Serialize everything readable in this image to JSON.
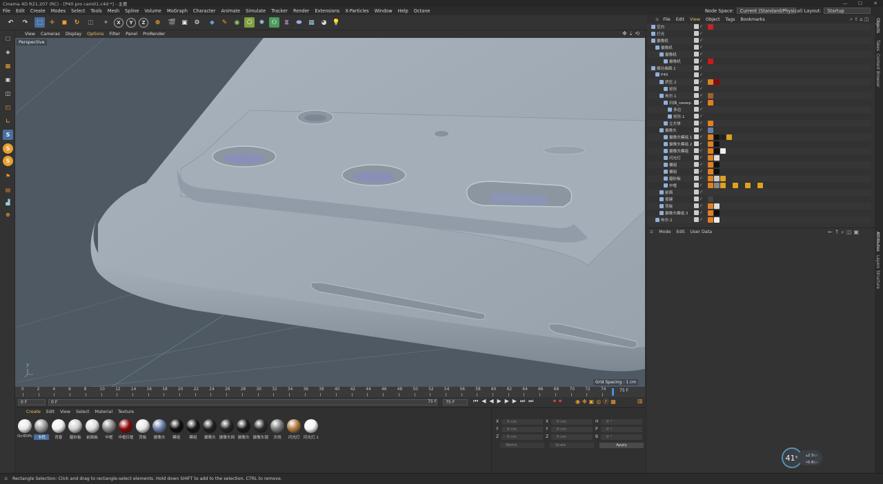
{
  "window": {
    "title": "Cinema 4D R21.207 (RC) - [P40 pro cam01.c4d *] - 主要",
    "min": "—",
    "max": "☐",
    "close": "✕"
  },
  "menubar": {
    "items": [
      "File",
      "Edit",
      "Create",
      "Modes",
      "Select",
      "Tools",
      "Mesh",
      "Spline",
      "Volume",
      "MoGraph",
      "Character",
      "Animate",
      "Simulate",
      "Tracker",
      "Render",
      "Extensions",
      "X-Particles",
      "Window",
      "Help",
      "Octane"
    ],
    "node_space_label": "Node Space:",
    "node_space_value": "Current (Standard/Physical)",
    "layout_label": "Layout:",
    "layout_value": "Startup"
  },
  "toolbar": {
    "axis_x": "X",
    "axis_y": "Y",
    "axis_z": "Z"
  },
  "viewport": {
    "menu": [
      "View",
      "Cameras",
      "Display",
      "Options",
      "Filter",
      "Panel",
      "ProRender"
    ],
    "camera_label": "Perspective",
    "grid_spacing": "Grid Spacing : 1 cm"
  },
  "timeline": {
    "ticks": [
      "0",
      "2",
      "4",
      "6",
      "8",
      "10",
      "12",
      "14",
      "16",
      "18",
      "20",
      "22",
      "24",
      "26",
      "28",
      "30",
      "32",
      "34",
      "36",
      "38",
      "40",
      "42",
      "44",
      "46",
      "48",
      "50",
      "52",
      "54",
      "56",
      "58",
      "60",
      "62",
      "64",
      "66",
      "68",
      "70",
      "72",
      "74"
    ],
    "current": "75 F"
  },
  "playbar": {
    "start": "0 F",
    "start2": "0 F",
    "end": "75 F",
    "end2": "75 F"
  },
  "materials": {
    "menu": [
      "Create",
      "Edit",
      "View",
      "Select",
      "Material",
      "Texture"
    ],
    "items": [
      {
        "label": "OctDiffu",
        "color": "#e8e8e8"
      },
      {
        "label": "卡托",
        "color": "#9a9a9a"
      },
      {
        "label": "背景",
        "color": "#f0f0f0"
      },
      {
        "label": "磨砂板",
        "color": "#d0d0d0"
      },
      {
        "label": "前面板",
        "color": "#dcdcdc"
      },
      {
        "label": "中框",
        "color": "#8a8a8a"
      },
      {
        "label": "中框红框",
        "color": "#8a0a0a"
      },
      {
        "label": "背板",
        "color": "#e4e4e4"
      },
      {
        "label": "摄像头",
        "color": "#6a7fa8"
      },
      {
        "label": "模组",
        "color": "#0d0d0d"
      },
      {
        "label": "模组",
        "color": "#151515"
      },
      {
        "label": "摄像头",
        "color": "#202020"
      },
      {
        "label": "摄像头网",
        "color": "#252525"
      },
      {
        "label": "摄像头",
        "color": "#1a1a1a"
      },
      {
        "label": "摄像头镜",
        "color": "#2a2a2a"
      },
      {
        "label": "天线",
        "color": "#7a7a7a"
      },
      {
        "label": "闪光灯",
        "color": "#b07a40"
      },
      {
        "label": "闪光灯.1",
        "color": "#f4f4f4"
      }
    ]
  },
  "coords": {
    "x": "X",
    "y": "Y",
    "z": "Z",
    "h": "H",
    "p": "P",
    "b": "B",
    "pos_x": "0 cm",
    "pos_y": "0 cm",
    "pos_z": "0 cm",
    "size_x": "0 cm",
    "size_y": "0 cm",
    "size_z": "0 cm",
    "rot_h": "0 °",
    "rot_p": "0 °",
    "rot_b": "0 °",
    "world": "World",
    "scale": "Scale",
    "apply": "Apply"
  },
  "objects": {
    "menu": [
      "File",
      "Edit",
      "View",
      "Object",
      "Tags",
      "Bookmarks"
    ],
    "rows": [
      {
        "name": "空白",
        "indent": 0,
        "tags": [
          {
            "color": "#cc2222"
          }
        ]
      },
      {
        "name": "灯光",
        "indent": 0,
        "tags": []
      },
      {
        "name": "摄像机",
        "indent": 0,
        "tags": []
      },
      {
        "name": "摄像机",
        "indent": 1,
        "tags": []
      },
      {
        "name": "摄像机",
        "indent": 2,
        "tags": []
      },
      {
        "name": "摄像机",
        "indent": 3,
        "tags": [
          {
            "color": "#d01818"
          }
        ]
      },
      {
        "name": "细分曲面.1",
        "indent": 0,
        "tags": []
      },
      {
        "name": "P40",
        "indent": 1,
        "tags": []
      },
      {
        "name": "挤压.2",
        "indent": 2,
        "tags": [
          {
            "color": "#e08020"
          },
          {
            "color": "#8a0a0a"
          }
        ]
      },
      {
        "name": "矩形",
        "indent": 3,
        "tags": []
      },
      {
        "name": "布尔.1",
        "indent": 2,
        "tags": [
          {
            "color": "#a06030"
          }
        ]
      },
      {
        "name": "扫描_sweep",
        "indent": 3,
        "tags": [
          {
            "color": "#e08020"
          }
        ]
      },
      {
        "name": "多边",
        "indent": 4,
        "tags": []
      },
      {
        "name": "矩形.1",
        "indent": 4,
        "tags": []
      },
      {
        "name": "立方体",
        "indent": 3,
        "tags": [
          {
            "color": "#e08020"
          }
        ]
      },
      {
        "name": "摄像头",
        "indent": 2,
        "tags": [
          {
            "color": "#6a7fa8"
          }
        ]
      },
      {
        "name": "摄像头模组.1",
        "indent": 3,
        "tags": [
          {
            "color": "#e08020"
          },
          {
            "color": "#111"
          },
          {
            "color": "#222"
          },
          {
            "color": "#e0a020"
          }
        ]
      },
      {
        "name": "摄像头模组.2",
        "indent": 3,
        "tags": [
          {
            "color": "#e08020"
          },
          {
            "color": "#111"
          }
        ]
      },
      {
        "name": "摄像头模组",
        "indent": 3,
        "tags": [
          {
            "color": "#e08020"
          },
          {
            "color": "#111"
          },
          {
            "color": "#eee"
          }
        ]
      },
      {
        "name": "闪光灯",
        "indent": 3,
        "tags": [
          {
            "color": "#e08020"
          },
          {
            "color": "#ddd"
          }
        ]
      },
      {
        "name": "模组",
        "indent": 3,
        "tags": [
          {
            "color": "#e08020"
          },
          {
            "color": "#111"
          }
        ]
      },
      {
        "name": "模组",
        "indent": 3,
        "tags": [
          {
            "color": "#e08020"
          },
          {
            "color": "#111"
          }
        ]
      },
      {
        "name": "磨砂板",
        "indent": 3,
        "tags": [
          {
            "color": "#e08020"
          },
          {
            "color": "#ccc"
          },
          {
            "color": "#e0a020"
          },
          {
            "color": "#333"
          }
        ]
      },
      {
        "name": "中框",
        "indent": 3,
        "tags": [
          {
            "color": "#e08020"
          },
          {
            "color": "#888"
          },
          {
            "color": "#e0a020"
          },
          {
            "color": "#333"
          },
          {
            "color": "#e0a020"
          },
          {
            "color": "#333"
          },
          {
            "color": "#e0a020"
          },
          {
            "color": "#333"
          },
          {
            "color": "#e0a020"
          }
        ]
      },
      {
        "name": "前面",
        "indent": 2,
        "tags": []
      },
      {
        "name": "按键",
        "indent": 2,
        "tags": [
          {
            "color": "#444"
          }
        ]
      },
      {
        "name": "背板",
        "indent": 2,
        "tags": [
          {
            "color": "#e08020"
          },
          {
            "color": "#ddd"
          }
        ]
      },
      {
        "name": "摄像头模组.3",
        "indent": 2,
        "tags": [
          {
            "color": "#e08020"
          },
          {
            "color": "#111"
          }
        ]
      },
      {
        "name": "布尔.2",
        "indent": 1,
        "tags": [
          {
            "color": "#e08020"
          },
          {
            "color": "#eee"
          }
        ]
      }
    ]
  },
  "attributes": {
    "menu": [
      "Mode",
      "Edit",
      "User Data"
    ]
  },
  "right_tabs": [
    "Objects",
    "Takes",
    "Content Browser",
    "Attributes",
    "Layers",
    "Structure"
  ],
  "status": {
    "text": "Rectangle Selection: Click and drag to rectangle-select elements. Hold down SHIFT to add to the selection, CTRL to remove."
  },
  "perf": {
    "percent": "41",
    "percent_unit": "%",
    "up": "2.5",
    "up_unit": "K/s",
    "down": "0.8",
    "down_unit": "K/s"
  }
}
